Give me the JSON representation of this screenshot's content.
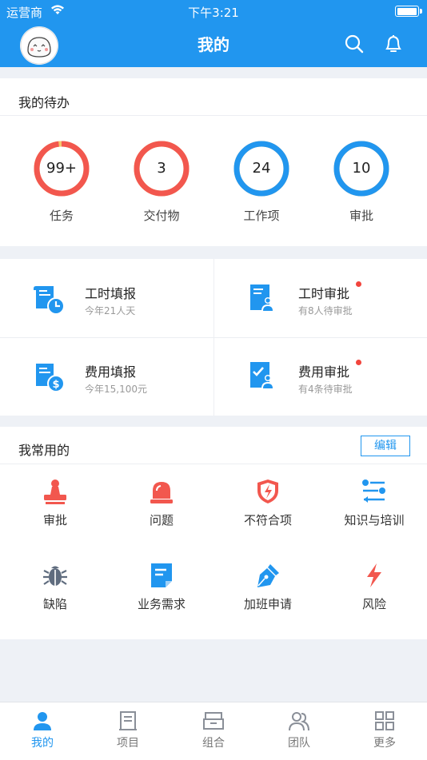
{
  "status_bar": {
    "carrier": "运营商",
    "time": "下午3:21"
  },
  "header": {
    "title": "我的"
  },
  "todo": {
    "title": "我的待办",
    "items": [
      {
        "value": "99+",
        "label": "任务",
        "color": "#f2574e",
        "progress": 0.98
      },
      {
        "value": "3",
        "label": "交付物",
        "color": "#f2574e",
        "progress": 1
      },
      {
        "value": "24",
        "label": "工作项",
        "color": "#2196ef",
        "progress": 1
      },
      {
        "value": "10",
        "label": "审批",
        "color": "#2196ef",
        "progress": 1
      }
    ]
  },
  "tiles": [
    {
      "title": "工时填报",
      "subtitle": "今年21人天",
      "icon": "timesheet-icon",
      "badge": false
    },
    {
      "title": "工时审批",
      "subtitle": "有8人待审批",
      "icon": "timesheet-approval-icon",
      "badge": true
    },
    {
      "title": "费用填报",
      "subtitle": "今年15,100元",
      "icon": "expense-icon",
      "badge": false
    },
    {
      "title": "费用审批",
      "subtitle": "有4条待审批",
      "icon": "expense-approval-icon",
      "badge": true
    }
  ],
  "favorites": {
    "title": "我常用的",
    "edit_label": "编辑",
    "items": [
      {
        "label": "审批",
        "icon": "stamp-icon",
        "color": "#f2574e"
      },
      {
        "label": "问题",
        "icon": "alarm-light-icon",
        "color": "#f2574e"
      },
      {
        "label": "不符合项",
        "icon": "shield-icon",
        "color": "#f2574e"
      },
      {
        "label": "知识与培训",
        "icon": "sliders-icon",
        "color": "#2196ef"
      },
      {
        "label": "缺陷",
        "icon": "bug-icon",
        "color": "#5f6c7e"
      },
      {
        "label": "业务需求",
        "icon": "document-icon",
        "color": "#2196ef"
      },
      {
        "label": "加班申请",
        "icon": "pen-nib-icon",
        "color": "#2196ef"
      },
      {
        "label": "风险",
        "icon": "lightning-icon",
        "color": "#f2574e"
      }
    ]
  },
  "tabbar": {
    "active_color": "#2196ef",
    "tabs": [
      {
        "label": "我的",
        "icon": "user-icon",
        "active": true
      },
      {
        "label": "项目",
        "icon": "project-icon",
        "active": false
      },
      {
        "label": "组合",
        "icon": "portfolio-icon",
        "active": false
      },
      {
        "label": "团队",
        "icon": "team-icon",
        "active": false
      },
      {
        "label": "更多",
        "icon": "grid-icon",
        "active": false
      }
    ]
  }
}
